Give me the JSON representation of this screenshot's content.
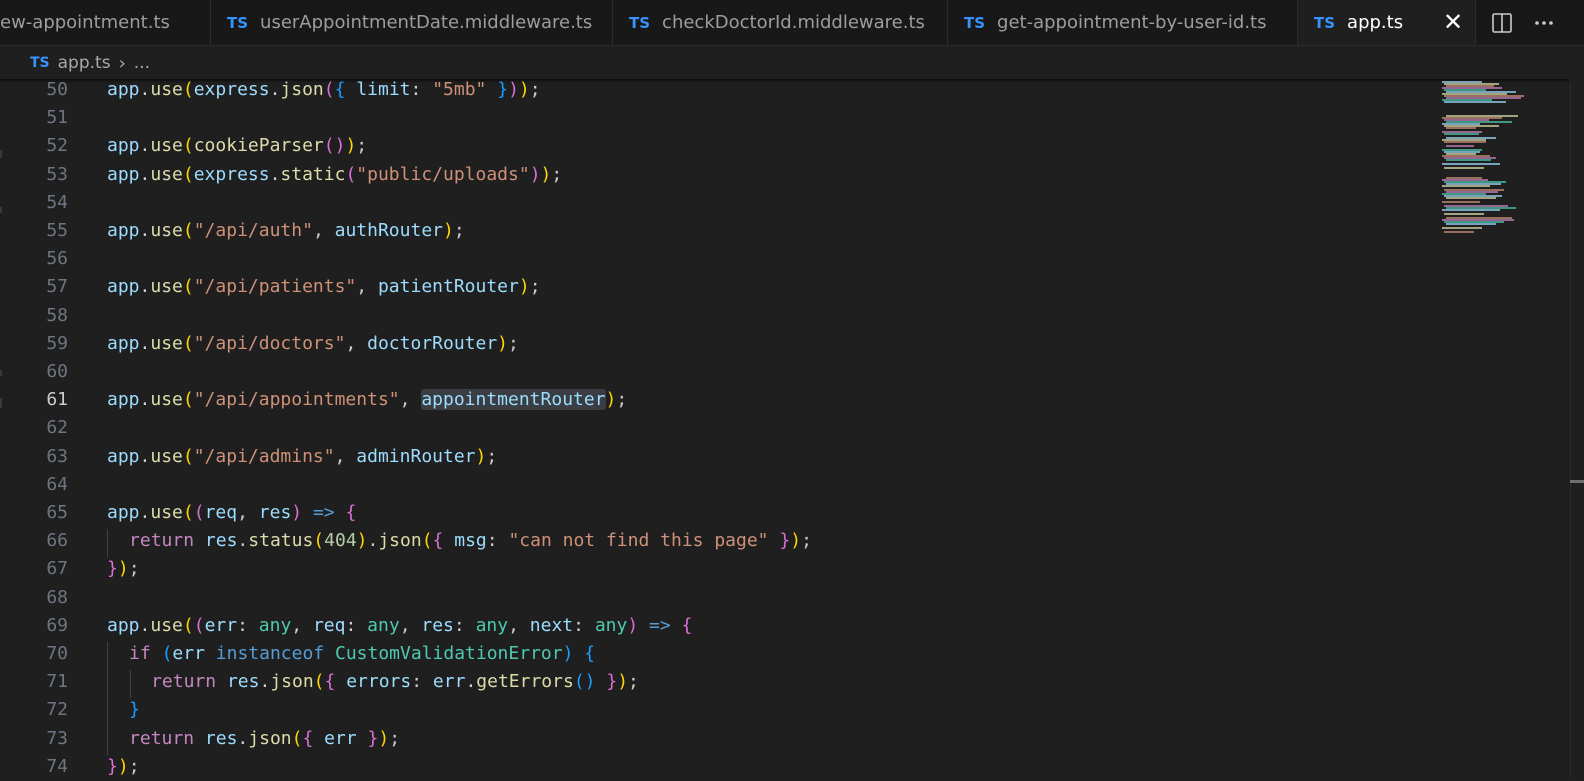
{
  "tabs": [
    {
      "label": "ew-appointment.ts",
      "icon": "ts-file-icon"
    },
    {
      "label": "userAppointmentDate.middleware.ts",
      "icon": "ts-file-icon"
    },
    {
      "label": "checkDoctorId.middleware.ts",
      "icon": "ts-file-icon"
    },
    {
      "label": "get-appointment-by-user-id.ts",
      "icon": "ts-file-icon"
    },
    {
      "label": "app.ts",
      "icon": "ts-file-icon",
      "active": true
    }
  ],
  "ts_badge": "TS",
  "tab_close_glyph": "✕",
  "tab_actions": [
    "split-editor-icon",
    "more-actions-icon"
  ],
  "breadcrumb": {
    "file": "app.ts",
    "separator": "›",
    "more": "..."
  },
  "line_numbers": [
    "50",
    "51",
    "52",
    "53",
    "54",
    "55",
    "56",
    "57",
    "58",
    "59",
    "60",
    "61",
    "62",
    "63",
    "64",
    "65",
    "66",
    "67",
    "68",
    "69",
    "70",
    "71",
    "72",
    "73",
    "74"
  ],
  "current_line": "61",
  "code": {
    "l50": [
      "app",
      ".",
      "use",
      "(",
      "express",
      ".",
      "json",
      "(",
      "{ ",
      "limit",
      ": ",
      "\"5mb\"",
      " }",
      ")",
      ")",
      ";"
    ],
    "l52": [
      "app",
      ".",
      "use",
      "(",
      "cookieParser",
      "(",
      ")",
      ")",
      ";"
    ],
    "l53": [
      "app",
      ".",
      "use",
      "(",
      "express",
      ".",
      "static",
      "(",
      "\"public/uploads\"",
      ")",
      ")",
      ";"
    ],
    "l55": [
      "app",
      ".",
      "use",
      "(",
      "\"/api/auth\"",
      ", ",
      "authRouter",
      ")",
      ";"
    ],
    "l57": [
      "app",
      ".",
      "use",
      "(",
      "\"/api/patients\"",
      ", ",
      "patientRouter",
      ")",
      ";"
    ],
    "l59": [
      "app",
      ".",
      "use",
      "(",
      "\"/api/doctors\"",
      ", ",
      "doctorRouter",
      ")",
      ";"
    ],
    "l61": [
      "app",
      ".",
      "use",
      "(",
      "\"/api/appointments\"",
      ", ",
      "appointmentRouter",
      ")",
      ";"
    ],
    "l63": [
      "app",
      ".",
      "use",
      "(",
      "\"/api/admins\"",
      ", ",
      "adminRouter",
      ")",
      ";"
    ],
    "l65": [
      "app",
      ".",
      "use",
      "(",
      "(",
      "req",
      ", ",
      "res",
      ")",
      " => ",
      "{"
    ],
    "l66": [
      "return",
      " ",
      "res",
      ".",
      "status",
      "(",
      "404",
      ")",
      ".",
      "json",
      "(",
      "{ ",
      "msg",
      ": ",
      "\"can not find this page\"",
      " }",
      ")",
      ";"
    ],
    "l67": [
      "}",
      ")",
      ";"
    ],
    "l69": [
      "app",
      ".",
      "use",
      "(",
      "(",
      "err",
      ": ",
      "any",
      ", ",
      "req",
      ": ",
      "any",
      ", ",
      "res",
      ": ",
      "any",
      ", ",
      "next",
      ": ",
      "any",
      ")",
      " => ",
      "{"
    ],
    "l70": [
      "if",
      " ",
      "(",
      "err",
      " ",
      "instanceof",
      " ",
      "CustomValidationError",
      ")",
      " ",
      "{"
    ],
    "l71": [
      "return",
      " ",
      "res",
      ".",
      "json",
      "(",
      "{ ",
      "errors",
      ": ",
      "err",
      ".",
      "getErrors",
      "(",
      ")",
      " }",
      ")",
      ";"
    ],
    "l72": [
      "}"
    ],
    "l73": [
      "return",
      " ",
      "res",
      ".",
      "json",
      "(",
      "{ ",
      "err",
      " }",
      ")",
      ";"
    ],
    "l74": [
      "}",
      ")",
      ";"
    ]
  },
  "colors": {
    "background": "#1f1f1f",
    "tabbar": "#181818",
    "variable": "#9cdcfe",
    "function": "#dcdcaa",
    "string": "#ce9178",
    "number": "#b5cea8",
    "type": "#4ec9b0",
    "keyword": "#569cd6",
    "control": "#c586c0",
    "bracket1": "#ffd700",
    "bracket2": "#da70d6",
    "bracket3": "#179fff",
    "ts_badge": "#3794ff"
  }
}
